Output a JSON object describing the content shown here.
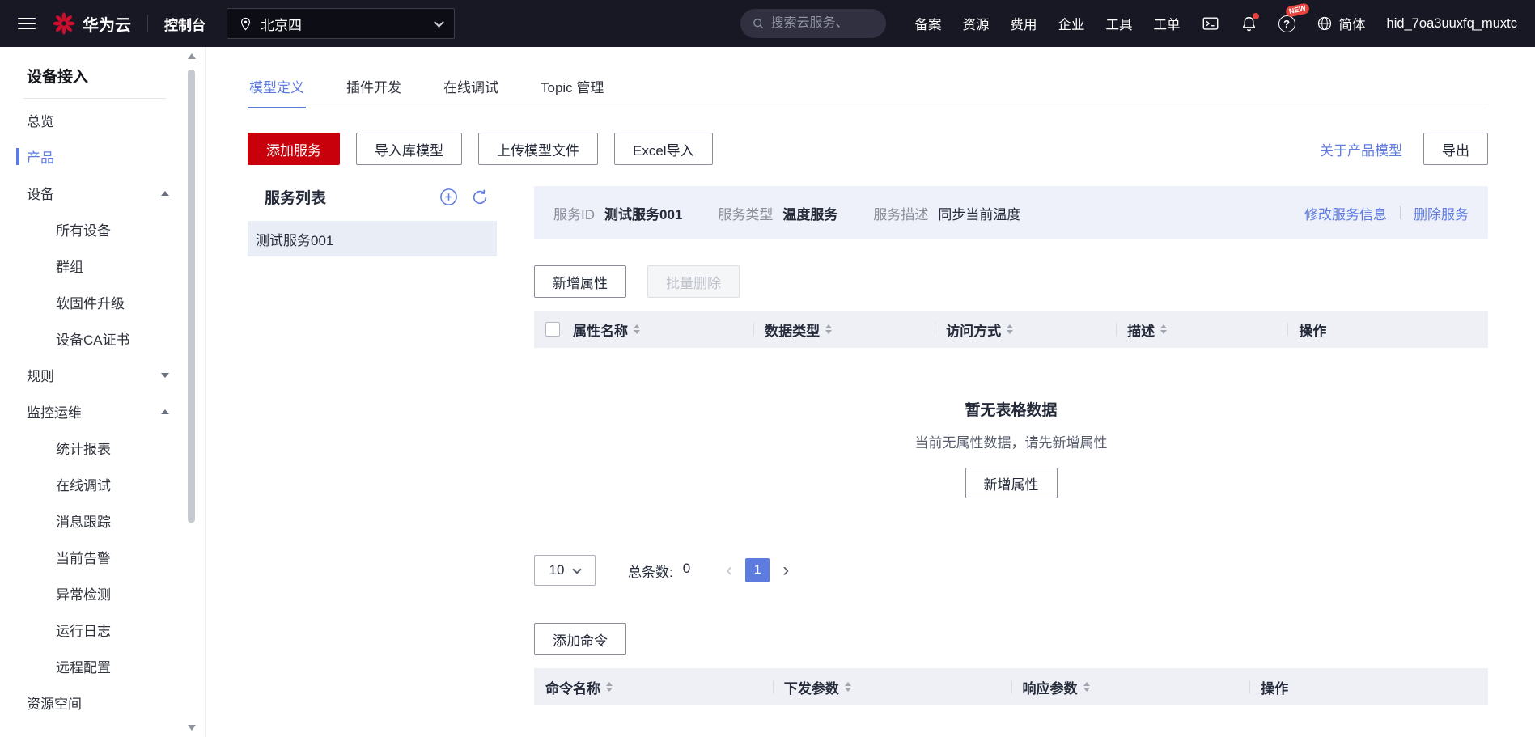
{
  "navbar": {
    "brand": "华为云",
    "console": "控制台",
    "region": "北京四",
    "search_placeholder": "搜索云服务、",
    "menu": [
      "备案",
      "资源",
      "费用",
      "企业",
      "工具",
      "工单"
    ],
    "new_badge": "NEW",
    "lang": "简体",
    "username": "hid_7oa3uuxfq_muxtc"
  },
  "sidebar": {
    "title": "设备接入",
    "items": [
      {
        "label": "总览"
      },
      {
        "label": "产品",
        "active": true
      },
      {
        "label": "设备",
        "expanded": true,
        "children": [
          "所有设备",
          "群组",
          "软固件升级",
          "设备CA证书"
        ]
      },
      {
        "label": "规则",
        "expanded": false
      },
      {
        "label": "监控运维",
        "expanded": true,
        "children": [
          "统计报表",
          "在线调试",
          "消息跟踪",
          "当前告警",
          "异常检测",
          "运行日志",
          "远程配置"
        ]
      },
      {
        "label": "资源空间"
      }
    ]
  },
  "tabs": [
    {
      "label": "模型定义",
      "active": true
    },
    {
      "label": "插件开发"
    },
    {
      "label": "在线调试"
    },
    {
      "label": "Topic 管理"
    }
  ],
  "toolbar": {
    "add_service": "添加服务",
    "import_library": "导入库模型",
    "upload_model": "上传模型文件",
    "excel_import": "Excel导入",
    "about_product_model": "关于产品模型",
    "export": "导出"
  },
  "service_list": {
    "title": "服务列表",
    "items": [
      "测试服务001"
    ]
  },
  "service_info": {
    "id_label": "服务ID",
    "id_value": "测试服务001",
    "type_label": "服务类型",
    "type_value": "温度服务",
    "desc_label": "服务描述",
    "desc_value": "同步当前温度",
    "edit_link": "修改服务信息",
    "delete_link": "删除服务"
  },
  "properties": {
    "add_button": "新增属性",
    "batch_delete_button": "批量删除",
    "columns": [
      "属性名称",
      "数据类型",
      "访问方式",
      "描述",
      "操作"
    ],
    "empty": {
      "title": "暂无表格数据",
      "description": "当前无属性数据，请先新增属性",
      "action": "新增属性"
    }
  },
  "pagination": {
    "page_size": "10",
    "total_label": "总条数:",
    "total_value": "0",
    "current_page": "1"
  },
  "commands": {
    "add_button": "添加命令",
    "columns": [
      "命令名称",
      "下发参数",
      "响应参数",
      "操作"
    ]
  },
  "colors": {
    "accent": "#5e7ce0",
    "brand_red": "#c7000b",
    "navbar_bg": "#181824",
    "table_header_bg": "#eef0f6",
    "info_bar_bg": "#eef1fa"
  }
}
